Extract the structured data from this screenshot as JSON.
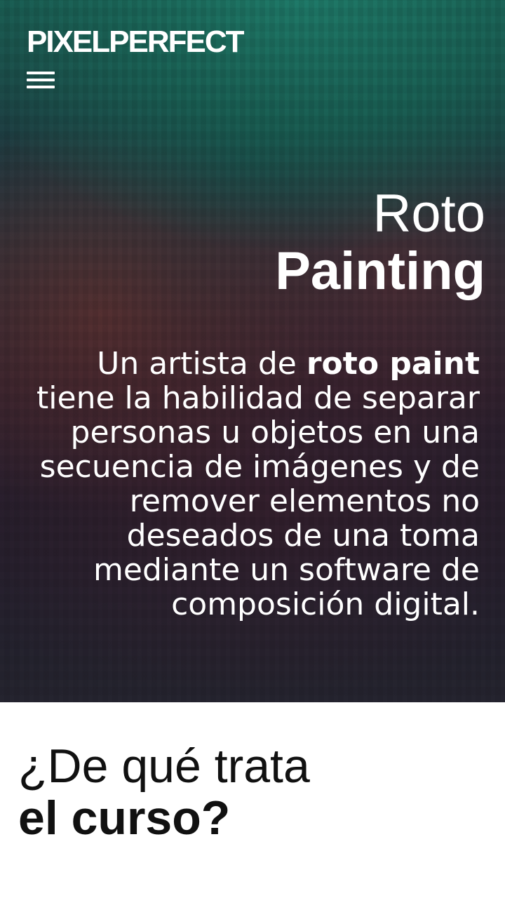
{
  "header": {
    "logo": "PIXELPERFECT",
    "menu_icon": "hamburger-icon"
  },
  "hero": {
    "title_light": "Roto",
    "title_bold": "Painting",
    "description_prefix": "Un artista de ",
    "description_bold": "roto paint",
    "description_rest": " tiene la habilidad de separar personas u objetos en una secuencia de imágenes y de remover elementos no deseados de una toma mediante un software de composición digital."
  },
  "course_section": {
    "heading_light": "¿De qué trata",
    "heading_bold": "el curso?"
  }
}
